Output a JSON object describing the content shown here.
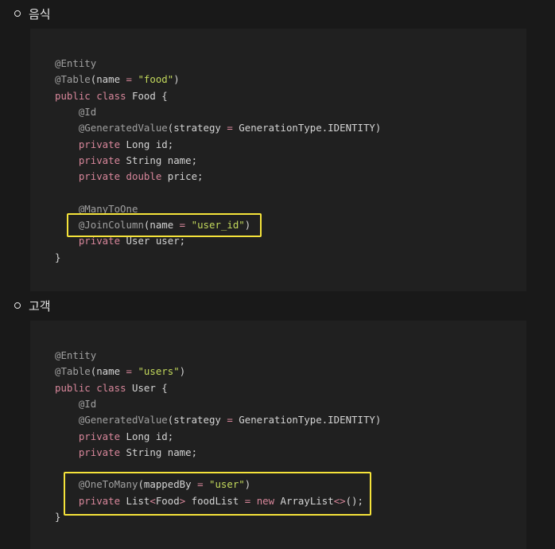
{
  "sections": [
    {
      "heading": "음식",
      "code": [
        [
          [
            "ann",
            "@Entity"
          ]
        ],
        [
          [
            "ann",
            "@Table"
          ],
          [
            "plain",
            "(name "
          ],
          [
            "op",
            "="
          ],
          [
            "plain",
            " "
          ],
          [
            "str",
            "\"food\""
          ],
          [
            "plain",
            ")"
          ]
        ],
        [
          [
            "kw",
            "public"
          ],
          [
            "plain",
            " "
          ],
          [
            "kw",
            "class"
          ],
          [
            "plain",
            " Food {"
          ]
        ],
        [
          [
            "plain",
            "    "
          ],
          [
            "ann",
            "@Id"
          ]
        ],
        [
          [
            "plain",
            "    "
          ],
          [
            "ann",
            "@GeneratedValue"
          ],
          [
            "plain",
            "(strategy "
          ],
          [
            "op",
            "="
          ],
          [
            "plain",
            " GenerationType.IDENTITY)"
          ]
        ],
        [
          [
            "plain",
            "    "
          ],
          [
            "kw",
            "private"
          ],
          [
            "plain",
            " Long id;"
          ]
        ],
        [
          [
            "plain",
            "    "
          ],
          [
            "kw",
            "private"
          ],
          [
            "plain",
            " String name;"
          ]
        ],
        [
          [
            "plain",
            "    "
          ],
          [
            "kw",
            "private"
          ],
          [
            "plain",
            " "
          ],
          [
            "kw",
            "double"
          ],
          [
            "plain",
            " price;"
          ]
        ],
        [],
        [
          [
            "plain",
            "    "
          ],
          [
            "ann",
            "@ManyToOne"
          ]
        ],
        [
          [
            "plain",
            "    "
          ],
          [
            "ann",
            "@JoinColumn"
          ],
          [
            "plain",
            "(name "
          ],
          [
            "op",
            "="
          ],
          [
            "plain",
            " "
          ],
          [
            "str",
            "\"user_id\""
          ],
          [
            "plain",
            ")"
          ]
        ],
        [
          [
            "plain",
            "    "
          ],
          [
            "kw",
            "private"
          ],
          [
            "plain",
            " User user;"
          ]
        ],
        [
          [
            "plain",
            "}"
          ]
        ]
      ]
    },
    {
      "heading": "고객",
      "code": [
        [
          [
            "ann",
            "@Entity"
          ]
        ],
        [
          [
            "ann",
            "@Table"
          ],
          [
            "plain",
            "(name "
          ],
          [
            "op",
            "="
          ],
          [
            "plain",
            " "
          ],
          [
            "str",
            "\"users\""
          ],
          [
            "plain",
            ")"
          ]
        ],
        [
          [
            "kw",
            "public"
          ],
          [
            "plain",
            " "
          ],
          [
            "kw",
            "class"
          ],
          [
            "plain",
            " User {"
          ]
        ],
        [
          [
            "plain",
            "    "
          ],
          [
            "ann",
            "@Id"
          ]
        ],
        [
          [
            "plain",
            "    "
          ],
          [
            "ann",
            "@GeneratedValue"
          ],
          [
            "plain",
            "(strategy "
          ],
          [
            "op",
            "="
          ],
          [
            "plain",
            " GenerationType.IDENTITY)"
          ]
        ],
        [
          [
            "plain",
            "    "
          ],
          [
            "kw",
            "private"
          ],
          [
            "plain",
            " Long id;"
          ]
        ],
        [
          [
            "plain",
            "    "
          ],
          [
            "kw",
            "private"
          ],
          [
            "plain",
            " String name;"
          ]
        ],
        [],
        [
          [
            "plain",
            "    "
          ],
          [
            "ann",
            "@OneToMany"
          ],
          [
            "plain",
            "(mappedBy "
          ],
          [
            "op",
            "="
          ],
          [
            "plain",
            " "
          ],
          [
            "str",
            "\"user\""
          ],
          [
            "plain",
            ")"
          ]
        ],
        [
          [
            "plain",
            "    "
          ],
          [
            "kw",
            "private"
          ],
          [
            "plain",
            " List"
          ],
          [
            "op",
            "<"
          ],
          [
            "plain",
            "Food"
          ],
          [
            "op",
            ">"
          ],
          [
            "plain",
            " foodList "
          ],
          [
            "op",
            "="
          ],
          [
            "plain",
            " "
          ],
          [
            "kw",
            "new"
          ],
          [
            "plain",
            " ArrayList"
          ],
          [
            "op",
            "<>"
          ],
          [
            "plain",
            "();"
          ]
        ],
        [
          [
            "plain",
            "}"
          ]
        ]
      ]
    }
  ],
  "colors": {
    "annotation": "#a0a0a0",
    "keyword": "#d7869a",
    "string": "#c3d95c",
    "plain": "#d4d4d4",
    "highlight": "#f5e33a"
  }
}
